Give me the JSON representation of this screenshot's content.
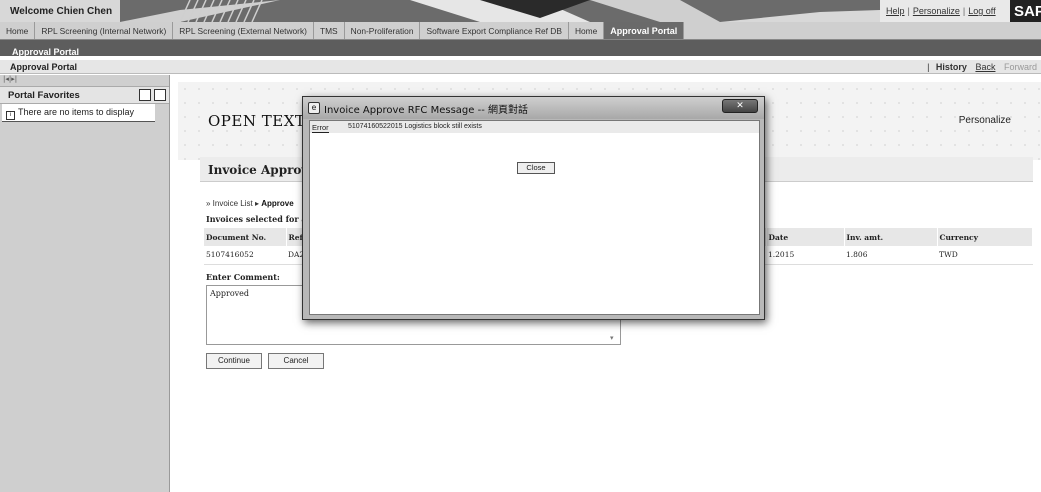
{
  "header": {
    "welcome": "Welcome Chien Chen",
    "links": [
      "Help",
      "Personalize",
      "Log off"
    ],
    "brand": "SAP"
  },
  "topnav": {
    "tabs": [
      {
        "label": "Home"
      },
      {
        "label": "RPL Screening (Internal Network)"
      },
      {
        "label": "RPL Screening (External Network)"
      },
      {
        "label": "TMS"
      },
      {
        "label": "Non-Proliferation"
      },
      {
        "label": "Software Export Compliance Ref DB"
      },
      {
        "label": "Home"
      },
      {
        "label": "Approval Portal"
      }
    ],
    "active_index": 7
  },
  "subnav": {
    "label": "Approval Portal"
  },
  "pagebar": {
    "title": "Approval Portal",
    "history": "History",
    "back": "Back",
    "forward": "Forward"
  },
  "left": {
    "toggle": "|◂|▸|",
    "title": "Portal Favorites",
    "empty_text": "There are no items to display"
  },
  "content": {
    "logo": "OPEN TEXT",
    "personalize": "Personalize",
    "section_title": "Invoice Approval",
    "breadcrumb_link": "Invoice List",
    "breadcrumb_current": "Approve",
    "selected_label": "Invoices selected for ap",
    "table": {
      "headers": [
        "Document No.",
        "Ref",
        "Date",
        "Inv. amt.",
        "Currency"
      ],
      "rows": [
        [
          "5107416052",
          "DA2",
          "1.2015",
          "1.806",
          "TWD"
        ]
      ]
    },
    "comment_label": "Enter Comment:",
    "comment_value": "Approved",
    "buttons": {
      "continue": "Continue",
      "cancel": "Cancel"
    }
  },
  "modal": {
    "title": "Invoice Approve RFC Message -- 網頁對話",
    "error_tag": "Error",
    "message": "51074160522015 Logistics block still exists",
    "close_label": "Close"
  },
  "colors": {
    "nav_active": "#6a6a6a",
    "subnav_bg": "#5d5d5d",
    "left_panel_bg": "#cfcfcf"
  }
}
